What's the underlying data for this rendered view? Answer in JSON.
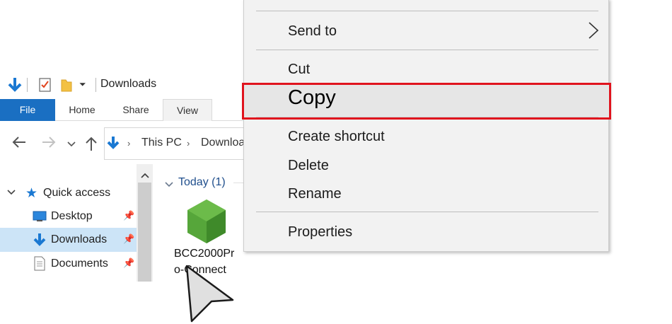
{
  "window": {
    "title": "Downloads"
  },
  "ribbon": {
    "tabs": [
      "File",
      "Home",
      "Share",
      "View"
    ]
  },
  "address_bar": {
    "crumbs": [
      "This PC",
      "Downloa"
    ]
  },
  "nav_pane": {
    "quick_access": "Quick access",
    "items": [
      {
        "label": "Desktop"
      },
      {
        "label": "Downloads"
      },
      {
        "label": "Documents"
      }
    ]
  },
  "content": {
    "group_header": "Today (1)",
    "file": {
      "name": "BCC2000Pro-Connect"
    }
  },
  "context_menu": {
    "send_to": "Send to",
    "cut": "Cut",
    "copy": "Copy",
    "create_shortcut": "Create shortcut",
    "delete": "Delete",
    "rename": "Rename",
    "properties": "Properties"
  },
  "colors": {
    "file_tab": "#1a6fc2",
    "selected_nav": "#cce4f7",
    "highlight_border": "#e0141e"
  }
}
